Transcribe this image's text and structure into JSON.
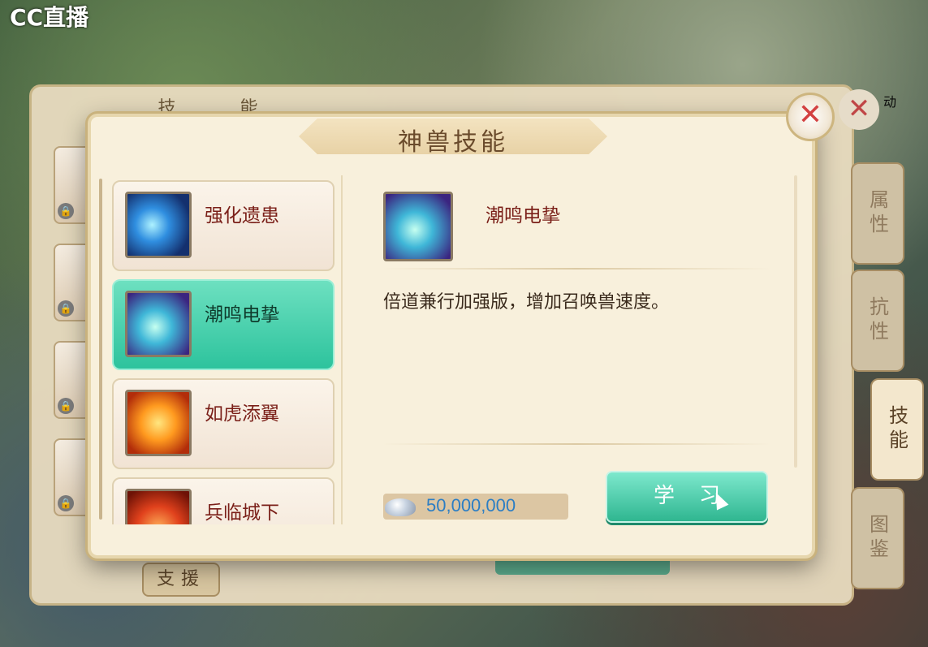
{
  "watermark": {
    "logo": "CC直播"
  },
  "hud": {
    "top_right_text": "动"
  },
  "back_panel": {
    "title": "技 能",
    "support_button": "支援",
    "side_tabs": [
      {
        "label": "属性"
      },
      {
        "label": "抗性"
      },
      {
        "label": "技能"
      },
      {
        "label": "图鉴"
      }
    ],
    "close_label": "✕"
  },
  "dialog": {
    "title": "神兽技能",
    "close_label": "✕",
    "skills": [
      {
        "name": "强化遗患",
        "icon": "blue-spirit-icon",
        "active": false
      },
      {
        "name": "潮鸣电挚",
        "icon": "teal-flame-icon",
        "active": true
      },
      {
        "name": "如虎添翼",
        "icon": "fire-guardian-icon",
        "active": false
      },
      {
        "name": "兵临城下",
        "icon": "red-blaze-icon",
        "active": false
      }
    ],
    "selected": {
      "name": "潮鸣电挚",
      "description": "倍道兼行加强版，增加召唤兽速度。"
    },
    "cost": {
      "currency_icon": "silver-ingot-icon",
      "value": "50,000,000"
    },
    "learn_button": "学习"
  },
  "colors": {
    "accent_green": "#2dc39d",
    "skill_name_red": "#7a1f18",
    "cost_blue": "#2c7ec4",
    "close_red": "#d34141"
  }
}
